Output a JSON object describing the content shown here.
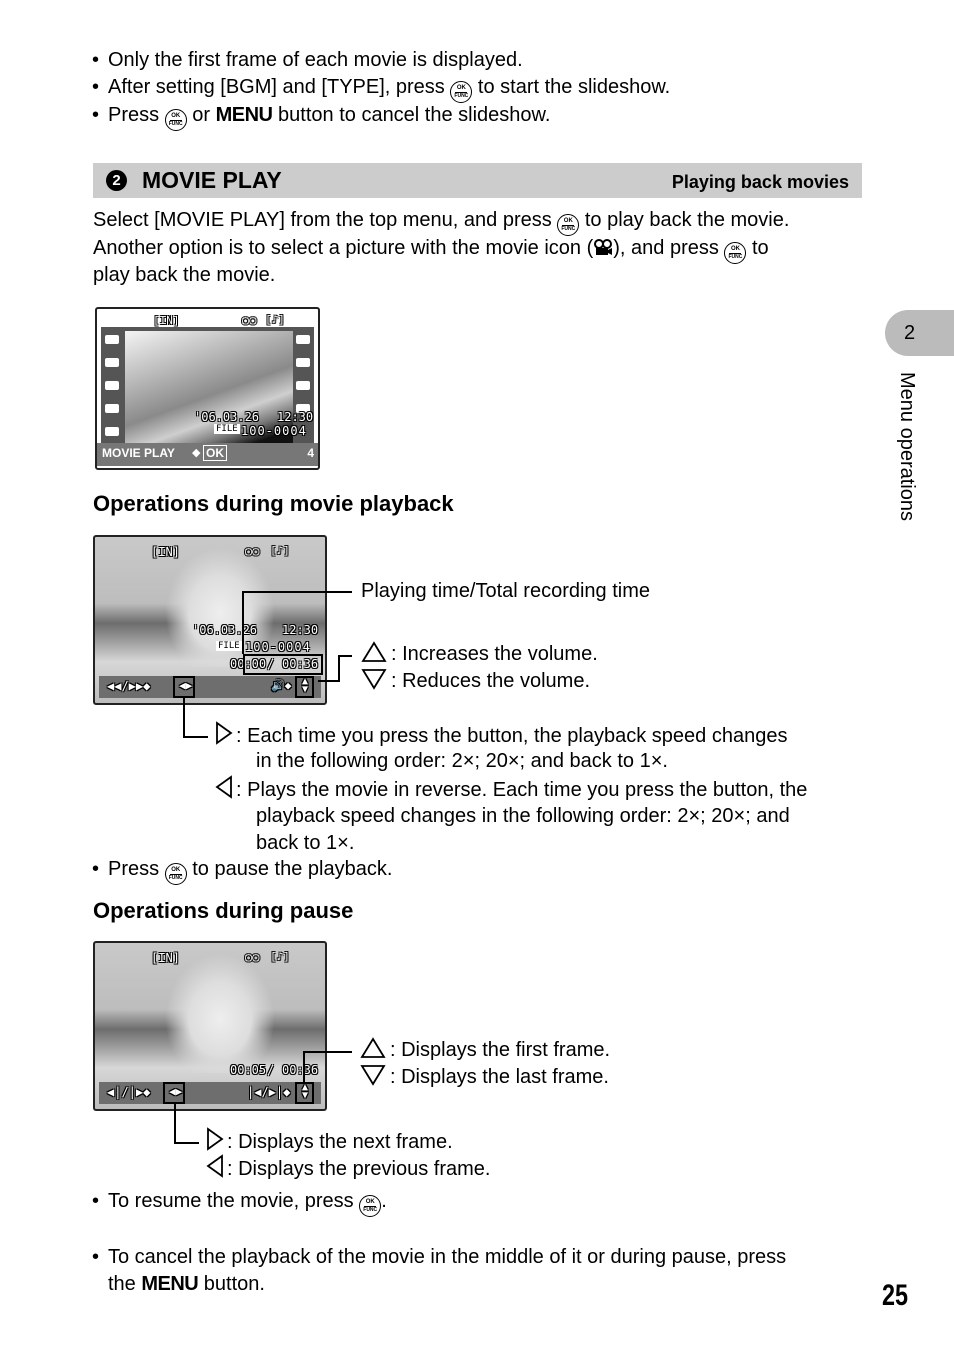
{
  "top_bullets": [
    "Only the first frame of each movie is displayed.",
    {
      "before": "After setting [BGM] and [TYPE], press ",
      "after": " to start the slideshow."
    },
    {
      "before": "Press ",
      "middle": " or ",
      "menu": "MENU",
      "after": " button to cancel the slideshow."
    }
  ],
  "ok_icon": {
    "top": "OK",
    "bottom": "FUNC"
  },
  "section": {
    "number": "2",
    "title": "MOVIE PLAY",
    "subtitle": "Playing back movies"
  },
  "intro": {
    "line1_before": "Select [MOVIE PLAY] from the top menu, and press ",
    "line1_after": " to play back the movie.",
    "line2_before": "Another option is to select a picture with the movie icon (",
    "line2_mid": "), and press ",
    "line2_after": " to",
    "line3": "play back the movie."
  },
  "screen1": {
    "memory": "[IN]",
    "date": "'06.03.26",
    "time": "12:30",
    "file": "100-0004",
    "footer_label": "MOVIE PLAY",
    "footer_ok": "OK",
    "frame_count": "4"
  },
  "playback": {
    "heading": "Operations during movie playback",
    "screen": {
      "memory": "[IN]",
      "date": "'06.03.26",
      "time": "12:30",
      "file": "100-0004",
      "elapsed": "00:00",
      "total": "00:36"
    },
    "callout_time": "Playing time/Total recording time",
    "vol_up": ": Increases the volume.",
    "vol_down": ": Reduces the volume.",
    "right_l1": ": Each time you press the button, the playback speed changes",
    "right_l2": "in the following order: 2×; 20×; and back to 1×.",
    "left_l1": ": Plays the movie in reverse. Each time you press the button, the",
    "left_l2": "playback speed changes in the following order: 2×; 20×; and",
    "left_l3": "back to 1×.",
    "pause_before": "Press ",
    "pause_after": " to pause the playback."
  },
  "pause": {
    "heading": "Operations during pause",
    "screen": {
      "memory": "[IN]",
      "elapsed": "00:05",
      "total": "00:36"
    },
    "up": ": Displays the first frame.",
    "down": ": Displays the last frame.",
    "right": ": Displays the next frame.",
    "left": ": Displays the previous frame.",
    "resume_before": "To resume the movie, press ",
    "resume_after": ".",
    "cancel_l1": "To cancel the playback of the movie in the middle of it or during pause, press",
    "cancel_l2_before": "the ",
    "cancel_l2_menu": "MENU",
    "cancel_l2_after": " button."
  },
  "side": {
    "chapter": "2",
    "label": "Menu operations"
  },
  "page_number": "25"
}
